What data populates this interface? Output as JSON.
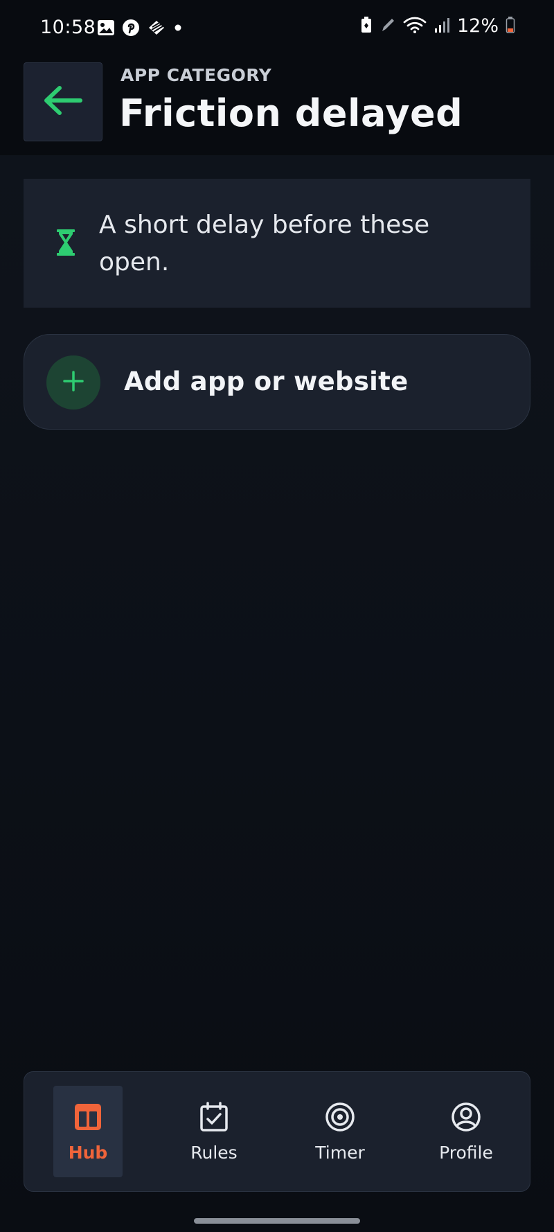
{
  "status_bar": {
    "time": "10:58",
    "battery": "12%",
    "icons_left": [
      "gallery-icon",
      "pinterest-icon",
      "app-icon",
      "dot-icon"
    ],
    "icons_right": [
      "battery-saver-icon",
      "pen-icon",
      "wifi-icon",
      "signal-icon",
      "battery-icon"
    ]
  },
  "header": {
    "kicker": "APP CATEGORY",
    "title": "Friction delayed",
    "back_icon": "arrow-left-icon"
  },
  "info_card": {
    "icon": "hourglass-icon",
    "text": "A short delay before these open."
  },
  "add_button": {
    "icon": "plus-icon",
    "label": "Add app or website"
  },
  "nav": {
    "items": [
      {
        "label": "Hub",
        "icon": "hub-icon",
        "active": true
      },
      {
        "label": "Rules",
        "icon": "calendar-check-icon",
        "active": false
      },
      {
        "label": "Timer",
        "icon": "target-icon",
        "active": false
      },
      {
        "label": "Profile",
        "icon": "profile-icon",
        "active": false
      }
    ]
  },
  "colors": {
    "accent_green": "#2ecc71",
    "accent_orange": "#f0643a",
    "card": "#1b212d",
    "background": "#0d1118"
  }
}
